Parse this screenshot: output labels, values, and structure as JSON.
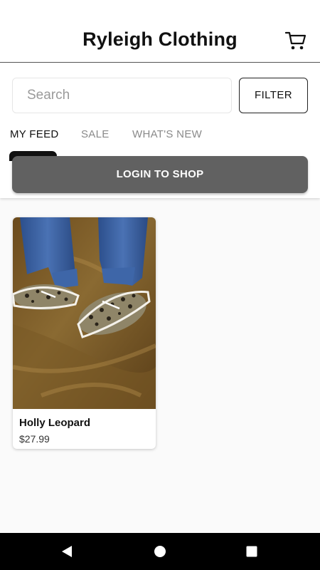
{
  "header": {
    "title": "Ryleigh Clothing",
    "cart_icon": "cart-icon"
  },
  "search": {
    "placeholder": "Search",
    "value": "",
    "filter_label": "FILTER"
  },
  "tabs": [
    {
      "label": "MY FEED",
      "active": true
    },
    {
      "label": "SALE",
      "active": false
    },
    {
      "label": "WHAT'S NEW",
      "active": false
    }
  ],
  "login_button": {
    "label": "LOGIN TO SHOP"
  },
  "products": [
    {
      "name": "Holly Leopard",
      "price": "$27.99",
      "image_icon": "product-photo-leopard-shoes"
    }
  ],
  "nav": {
    "back_icon": "back-icon",
    "home_icon": "home-icon",
    "recents_icon": "recents-icon"
  },
  "colors": {
    "login_button_bg": "#616161",
    "nav_bg": "#000000",
    "page_bg": "#fafafa"
  }
}
